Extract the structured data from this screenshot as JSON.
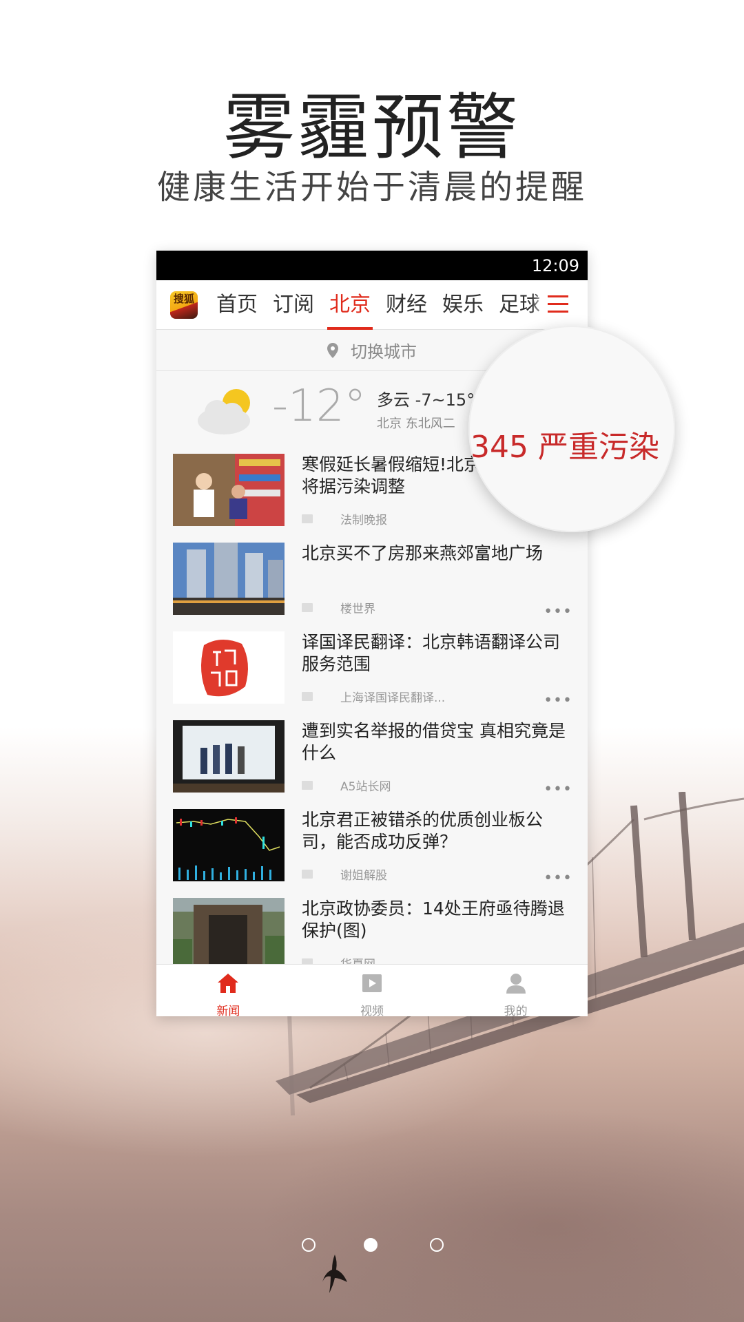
{
  "promo": {
    "headline": "雾霾预警",
    "subline": "健康生活开始于清晨的提醒"
  },
  "status_bar": {
    "time": "12:09"
  },
  "app": {
    "logo_text": "搜狐",
    "tabs": [
      "首页",
      "订阅",
      "北京",
      "财经",
      "娱乐",
      "足球"
    ],
    "active_tab": "北京"
  },
  "city_switch": {
    "label": "切换城市"
  },
  "weather": {
    "temperature": "-12°",
    "condition": "多云 -7~15°",
    "location_wind": "北京   东北风二"
  },
  "magnifier": {
    "aqi_text": "345 严重污染"
  },
  "news": [
    {
      "title": "寒假延长暑假缩短!北京中小学假期将据污染调整",
      "source": "法制晚报",
      "thumb": "library-kids"
    },
    {
      "title": "北京买不了房那来燕郊富地广场",
      "source": "楼世界",
      "thumb": "buildings"
    },
    {
      "title": "译国译民翻译：北京韩语翻译公司服务范围",
      "source": "上海译国译民翻译...",
      "thumb": "seal"
    },
    {
      "title": "遭到实名举报的借贷宝 真相究竟是什么",
      "source": "A5站长网",
      "thumb": "billboard"
    },
    {
      "title": "北京君正被错杀的优质创业板公司，能否成功反弹？",
      "source": "谢姐解股",
      "thumb": "stock-chart"
    },
    {
      "title": "北京政协委员：14处王府亟待腾退保护(图)",
      "source": "华夏网",
      "thumb": "old-gate"
    }
  ],
  "more_label": "•••",
  "bottom_nav": [
    {
      "label": "新闻",
      "icon": "home-icon",
      "active": true
    },
    {
      "label": "视频",
      "icon": "video-icon",
      "active": false
    },
    {
      "label": "我的",
      "icon": "user-icon",
      "active": false
    }
  ],
  "pager": {
    "count": 3,
    "active_index": 1
  },
  "colors": {
    "accent": "#e02b1c",
    "aqi_red": "#c82a2a"
  }
}
